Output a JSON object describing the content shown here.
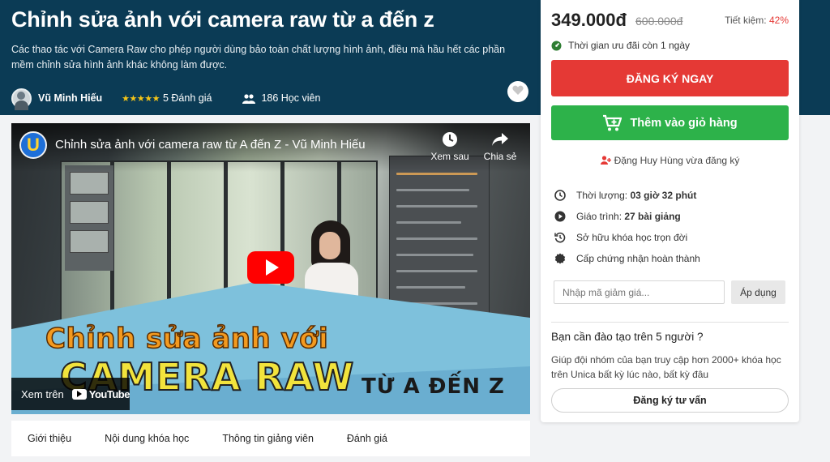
{
  "course": {
    "title": "Chỉnh sửa ảnh với camera raw từ a đến z",
    "description": "Các thao tác với Camera Raw cho phép người dùng bảo toàn chất lượng hình ảnh, điều mà hầu hết các phần mềm chỉnh sửa hình ảnh khác không làm được.",
    "author": "Vũ Minh Hiếu",
    "stars": "★★★★★",
    "reviews": "5 Đánh giá",
    "students": "186 Học viên"
  },
  "video": {
    "title": "Chỉnh sửa ảnh với camera raw từ A đến Z - Vũ Minh Hiếu",
    "channel_letter": "U",
    "watch_later": "Xem sau",
    "share": "Chia sẻ",
    "watch_on": "Xem trên",
    "youtube": "YouTube",
    "banner_line1": "Chỉnh sửa ảnh với",
    "banner_line2": "CAMERA RAW",
    "banner_line3": "TỪ A ĐẾN Z"
  },
  "tabs": [
    "Giới thiệu",
    "Nội dung khóa học",
    "Thông tin giảng viên",
    "Đánh giá"
  ],
  "sidebar": {
    "price": "349.000đ",
    "old_price": "600.000đ",
    "save_label": "Tiết kiệm:",
    "save_pct": "42%",
    "promo": "Thời gian ưu đãi còn 1 ngày",
    "register_button": "ĐĂNG KÝ NGAY",
    "cart_button": "Thêm vào giỏ hàng",
    "recent_signup": "Đặng Huy Hùng vừa đăng ký",
    "features": [
      {
        "label": "Thời lượng:",
        "value": "03 giờ 32 phút",
        "icon": "clock-icon"
      },
      {
        "label": "Giáo trình:",
        "value": "27 bài giảng",
        "icon": "play-circle-icon"
      },
      {
        "label": "Sở hữu khóa học trọn đời",
        "value": "",
        "icon": "history-icon"
      },
      {
        "label": "Cấp chứng nhận hoàn thành",
        "value": "",
        "icon": "certificate-icon"
      }
    ],
    "coupon_placeholder": "Nhập mã giảm giá...",
    "coupon_button": "Áp dụng",
    "team_title": "Bạn cần đào tạo trên 5 người ?",
    "team_desc": "Giúp đội nhóm của bạn truy cập hơn 2000+ khóa học trên Unica bất kỳ lúc nào, bất kỳ đâu",
    "consult_button": "Đăng ký tư vấn"
  },
  "colors": {
    "hero_bg": "#0b3b55",
    "register": "#e53935",
    "cart": "#2db24a",
    "stars": "#f5c518"
  }
}
